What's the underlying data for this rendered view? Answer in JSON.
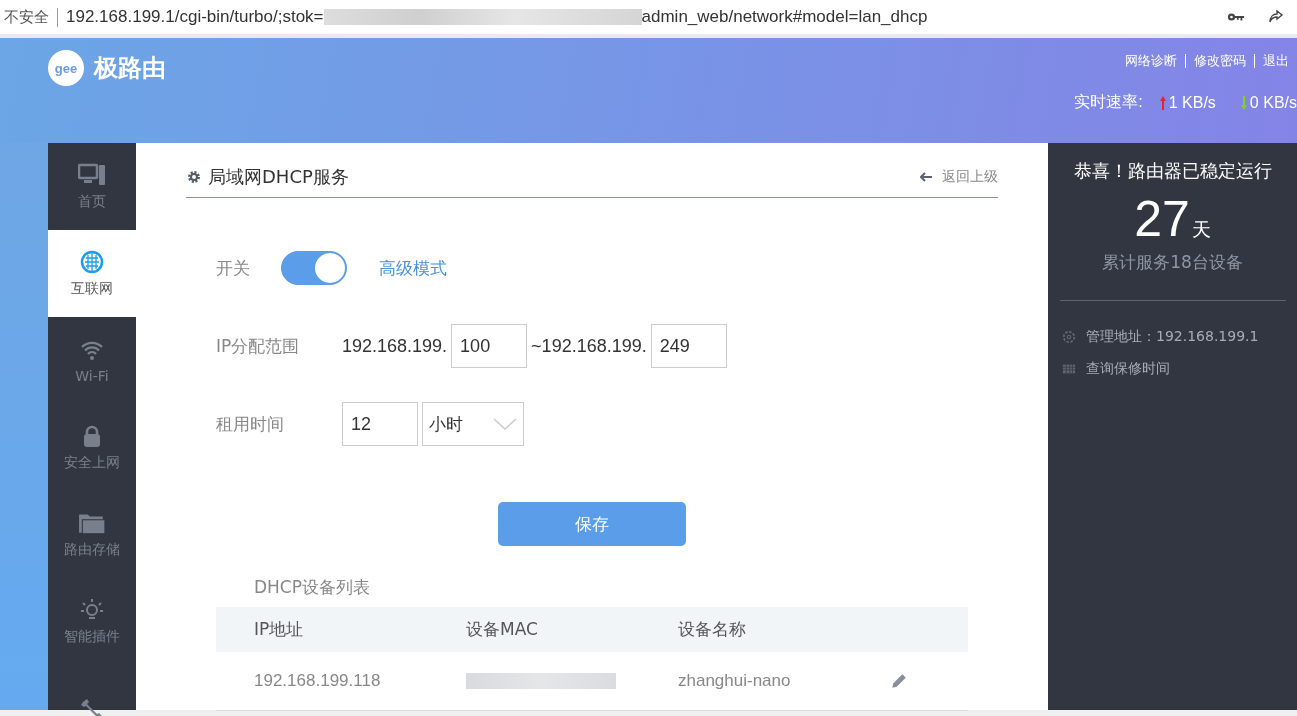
{
  "browser": {
    "security": "不安全",
    "url_start": "192.168.199.1/cgi-bin/turbo/;stok=",
    "url_end": "admin_web/network#model=lan_dhcp"
  },
  "header": {
    "brand": "极路由",
    "logo_text": "gee",
    "links": [
      "网络诊断",
      "修改密码",
      "退出"
    ],
    "speed_label": "实时速率:",
    "upload": "1 KB/s",
    "download": "0 KB/s"
  },
  "sidebar": {
    "items": [
      {
        "label": "首页",
        "selected": false
      },
      {
        "label": "互联网",
        "selected": true
      },
      {
        "label": "Wi-Fi",
        "selected": false
      },
      {
        "label": "安全上网",
        "selected": false
      },
      {
        "label": "路由存储",
        "selected": false
      },
      {
        "label": "智能插件",
        "selected": false
      },
      {
        "selected": false
      }
    ]
  },
  "panel": {
    "title": "局域网DHCP服务",
    "back": "返回上级",
    "switch": {
      "label": "开关",
      "on": true,
      "advanced": "高级模式"
    },
    "range": {
      "label": "IP分配范围",
      "prefix_start": "192.168.199.",
      "start": "100",
      "prefix_end": "~192.168.199.",
      "end": "249"
    },
    "lease": {
      "label": "租用时间",
      "value": "12",
      "unit": "小时"
    },
    "save": "保存",
    "table": {
      "title": "DHCP设备列表",
      "columns": [
        "IP地址",
        "设备MAC",
        "设备名称"
      ],
      "rows": [
        {
          "ip": "192.168.199.118",
          "name": "zhanghui-nano"
        }
      ]
    }
  },
  "status": {
    "title": "恭喜！路由器已稳定运行",
    "days": "27",
    "unit": "天",
    "devices": "累计服务18台设备",
    "admin": "管理地址：192.168.199.1",
    "warranty": "查询保修时间"
  }
}
